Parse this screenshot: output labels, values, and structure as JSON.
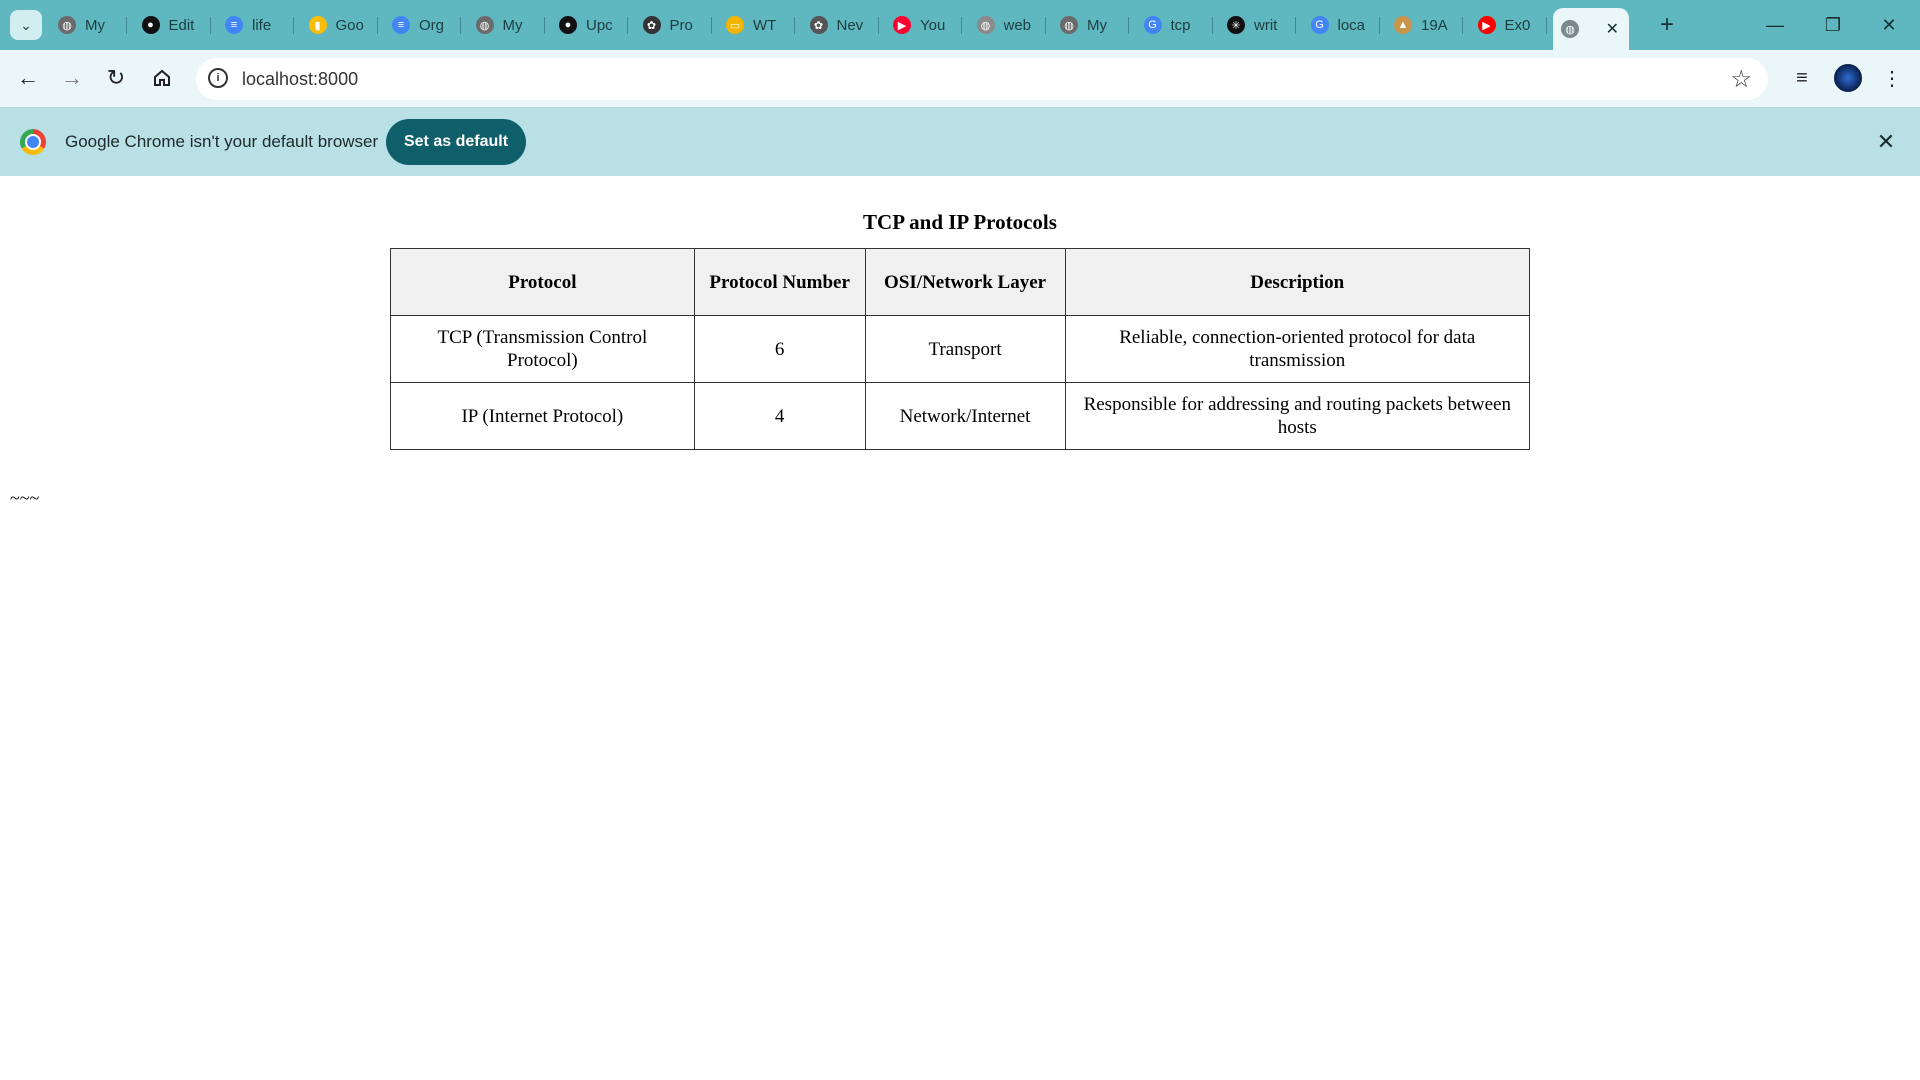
{
  "tabs": [
    {
      "label": "My",
      "icon": "globe-icon",
      "color": "#6b6b6b"
    },
    {
      "label": "Edit",
      "icon": "github-icon",
      "color": "#111111"
    },
    {
      "label": "life",
      "icon": "docs-icon",
      "color": "#4285f4"
    },
    {
      "label": "Goo",
      "icon": "keep-icon",
      "color": "#fbbc04"
    },
    {
      "label": "Org",
      "icon": "docs-icon",
      "color": "#4285f4"
    },
    {
      "label": "My",
      "icon": "globe-icon",
      "color": "#6b6b6b"
    },
    {
      "label": "Upc",
      "icon": "github-icon",
      "color": "#111111"
    },
    {
      "label": "Pro",
      "icon": "openai-icon",
      "color": "#333333"
    },
    {
      "label": "WT",
      "icon": "slides-icon",
      "color": "#f4b400"
    },
    {
      "label": "Nev",
      "icon": "openai-icon",
      "color": "#555555"
    },
    {
      "label": "You",
      "icon": "youtube-music-icon",
      "color": "#ff0033"
    },
    {
      "label": "web",
      "icon": "globe-icon",
      "color": "#8a8a8a"
    },
    {
      "label": "My",
      "icon": "globe-icon",
      "color": "#6b6b6b"
    },
    {
      "label": "tcp",
      "icon": "google-icon",
      "color": "#4285f4"
    },
    {
      "label": "writ",
      "icon": "perplexity-icon",
      "color": "#111111"
    },
    {
      "label": "loca",
      "icon": "google-icon",
      "color": "#4285f4"
    },
    {
      "label": "19A",
      "icon": "image-icon",
      "color": "#c8954b"
    },
    {
      "label": "Ex0",
      "icon": "youtube-icon",
      "color": "#ff0000"
    }
  ],
  "active_tab": {
    "icon": "globe-icon",
    "close": "✕"
  },
  "toolbar": {
    "url": "localhost:8000"
  },
  "infobar": {
    "message": "Google Chrome isn't your default browser",
    "button": "Set as default"
  },
  "page": {
    "caption": "TCP and IP Protocols",
    "headers": [
      "Protocol",
      "Protocol Number",
      "OSI/Network Layer",
      "Description"
    ],
    "rows": [
      [
        "TCP (Transmission Control Protocol)",
        "6",
        "Transport",
        "Reliable, connection-oriented protocol for data transmission"
      ],
      [
        "IP (Internet Protocol)",
        "4",
        "Network/Internet",
        "Responsible for addressing and routing packets between hosts"
      ]
    ],
    "footer_text": "~~~"
  }
}
